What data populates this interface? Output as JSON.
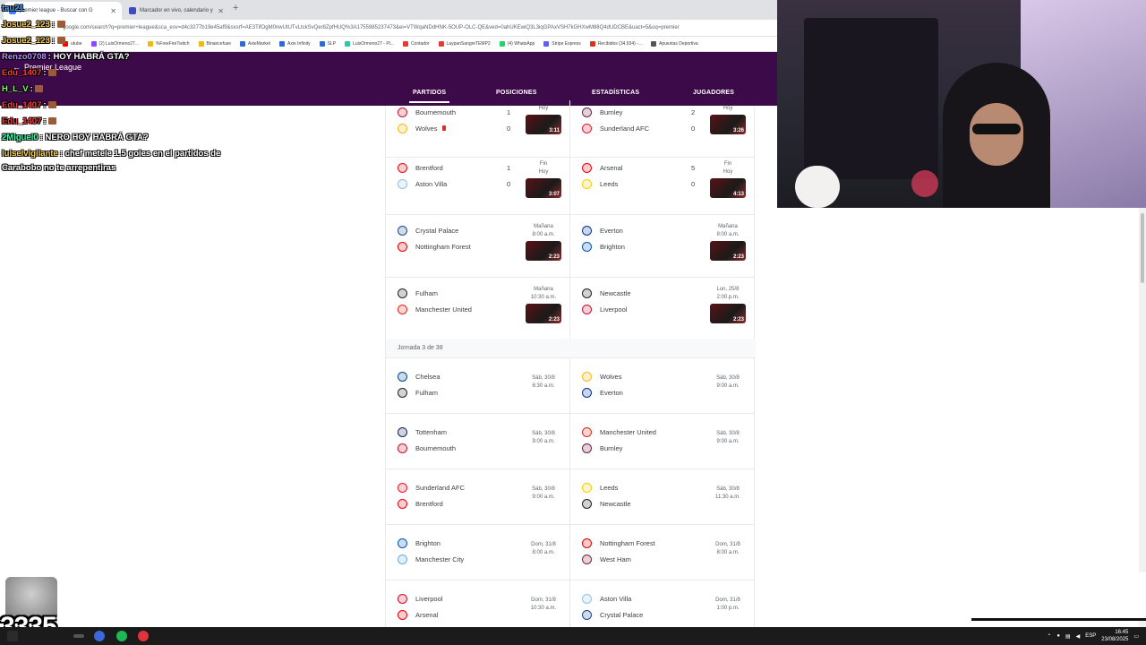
{
  "browser": {
    "tabs": [
      {
        "label": "premier league - Buscar con G",
        "active": true
      },
      {
        "label": "Marcador en vivo, calendario y",
        "active": false
      }
    ],
    "url": "google.com/search?q=premier+league&sca_esv=d4c3277b19e45af9&sxsrf=AE3TifOgM0nwUtUTvLtckSvQer8ZpfHUQ%3A1755985237473&ei=VTWqaNDdHNK-5OUP-OLC-QE&ved=0ahUKEwiQ3L3iqGPAxVSH7kGHXwM88Q4dUDCBE&uact=5&oq=premier",
    "bookmarks": [
      "utube",
      "(2) LuisOrmeno27...",
      "%FreeFireTwitch",
      "Binancefuse",
      "AxieMarket",
      "Axie Infinity",
      "SLP",
      "LuisOrmeno27 - Pl...",
      "Contador",
      "LaypanSangreTEMP2",
      "(4) WhatsApp",
      "Stripe Express",
      "Recibidos (34,934) -...",
      "Apuestas Deportiva"
    ]
  },
  "sports": {
    "back_label": "Premier League",
    "tabs": [
      "PARTIDOS",
      "POSICIONES",
      "ESTADÍSTICAS",
      "JUGADORES"
    ]
  },
  "fixtures": {
    "round_label": "Jornada 3 de 38",
    "played": [
      {
        "home": "Bournemouth",
        "away": "Wolves",
        "home_score": "1",
        "away_score": "0",
        "status": "Hoy",
        "duration": "3:11",
        "home_color": "#c8102e",
        "away_color": "#fdb913"
      },
      {
        "home": "Burnley",
        "away": "Sunderland AFC",
        "home_score": "2",
        "away_score": "0",
        "status": "Hoy",
        "duration": "3:26",
        "home_color": "#6c1d45",
        "away_color": "#eb172b"
      },
      {
        "home": "Brentford",
        "away": "Aston Villa",
        "home_score": "1",
        "away_score": "0",
        "status": "Fin",
        "status2": "Hoy",
        "duration": "3:07",
        "home_color": "#e30613",
        "away_color": "#95bfe5"
      },
      {
        "home": "Arsenal",
        "away": "Leeds",
        "home_score": "5",
        "away_score": "0",
        "status": "Fin",
        "status2": "Hoy",
        "duration": "4:13",
        "home_color": "#ef0107",
        "away_color": "#ffcd00"
      },
      {
        "home": "Crystal Palace",
        "away": "Nottingham Forest",
        "status": "Mañana",
        "status2": "8:00 a.m.",
        "duration": "2:23",
        "home_color": "#1b458f",
        "away_color": "#dd0000"
      },
      {
        "home": "Everton",
        "away": "Brighton",
        "status": "Mañana",
        "status2": "8:00 a.m.",
        "duration": "2:23",
        "home_color": "#003399",
        "away_color": "#0057b8"
      },
      {
        "home": "Fulham",
        "away": "Manchester United",
        "status": "Mañana",
        "status2": "10:30 a.m.",
        "duration": "2:23",
        "home_color": "#222222",
        "away_color": "#da291c"
      },
      {
        "home": "Newcastle",
        "away": "Liverpool",
        "status": "Lun, 25/8",
        "status2": "2:00 p.m.",
        "duration": "2:23",
        "home_color": "#241f20",
        "away_color": "#c8102e"
      }
    ],
    "upcoming": [
      {
        "home": "Chelsea",
        "away": "Fulham",
        "date": "Sáb, 30/8",
        "time": "6:30 a.m.",
        "home_color": "#034694",
        "away_color": "#222222"
      },
      {
        "home": "Wolves",
        "away": "Everton",
        "date": "Sáb, 30/8",
        "time": "9:00 a.m.",
        "home_color": "#fdb913",
        "away_color": "#003399"
      },
      {
        "home": "Tottenham",
        "away": "Bournemouth",
        "date": "Sáb, 30/8",
        "time": "9:00 a.m.",
        "home_color": "#132257",
        "away_color": "#c8102e"
      },
      {
        "home": "Manchester United",
        "away": "Burnley",
        "date": "Sáb, 30/8",
        "time": "9:00 a.m.",
        "home_color": "#da291c",
        "away_color": "#6c1d45"
      },
      {
        "home": "Sunderland AFC",
        "away": "Brentford",
        "date": "Sáb, 30/8",
        "time": "9:00 a.m.",
        "home_color": "#eb172b",
        "away_color": "#e30613"
      },
      {
        "home": "Leeds",
        "away": "Newcastle",
        "date": "Sáb, 30/8",
        "time": "11:30 a.m.",
        "home_color": "#ffcd00",
        "away_color": "#241f20"
      },
      {
        "home": "Brighton",
        "away": "Manchester City",
        "date": "Dom, 31/8",
        "time": "8:00 a.m.",
        "home_color": "#0057b8",
        "away_color": "#6cabdd"
      },
      {
        "home": "Nottingham Forest",
        "away": "West Ham",
        "date": "Dom, 31/8",
        "time": "8:00 a.m.",
        "home_color": "#dd0000",
        "away_color": "#7a263a"
      },
      {
        "home": "Liverpool",
        "away": "Arsenal",
        "date": "Dom, 31/8",
        "time": "10:30 a.m.",
        "home_color": "#c8102e",
        "away_color": "#ef0107"
      },
      {
        "home": "Aston Villa",
        "away": "Crystal Palace",
        "date": "Dom, 31/8",
        "time": "1:00 p.m.",
        "home_color": "#95bfe5",
        "away_color": "#1b458f"
      }
    ]
  },
  "chat": [
    {
      "user": "tau21",
      "color": "#4aa3ff",
      "text": ""
    },
    {
      "user": "Josue2_123",
      "color": "#f5c542",
      "text": ":"
    },
    {
      "user": "Josue2_123",
      "color": "#f5c542",
      "text": ":"
    },
    {
      "user": "Renzo0708",
      "color": "#b78cff",
      "text": ": HOY HABRÁ GTA?"
    },
    {
      "user": "Edu_1407",
      "color": "#ff3b3b",
      "text": ":"
    },
    {
      "user": "H_L_V",
      "color": "#7dff4a",
      "text": ":"
    },
    {
      "user": "Edu_1407",
      "color": "#ff3b3b",
      "text": ":"
    },
    {
      "user": "Edu_1407",
      "color": "#ff3b3b",
      "text": ":"
    },
    {
      "user": "2Miguel0",
      "color": "#3bffb0",
      "text": ": NERO HOY HABRÁ GTA?"
    },
    {
      "user": "luiselvigilante",
      "color": "#ffd24a",
      "text": ": chef metele 1.5 goles en el partidos de"
    },
    {
      "user": "",
      "color": "#ffffff",
      "text": "Carabobo no te arrepentiras"
    }
  ],
  "overlay": {
    "counter": "3335"
  },
  "taskbar": {
    "lang": "ESP",
    "time": "16:45",
    "date": "23/08/2025"
  }
}
